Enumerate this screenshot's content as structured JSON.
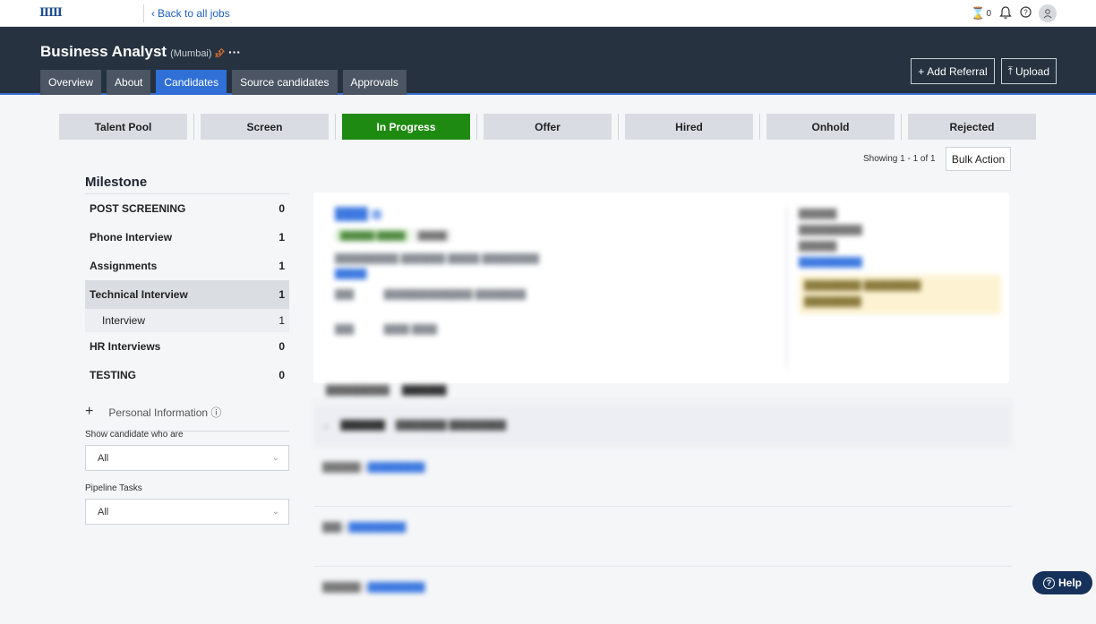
{
  "topbar": {
    "logo_text": "ⅡⅢ",
    "back_label": "Back to all jobs",
    "hourglass_count": "0"
  },
  "header": {
    "job_title": "Business Analyst",
    "location": "(Mumbai)",
    "tabs": [
      "Overview",
      "About",
      "Candidates",
      "Source candidates",
      "Approvals"
    ],
    "active_tab": "Candidates",
    "add_referral_label": "Add Referral",
    "upload_label": "Upload"
  },
  "stages": [
    "Talent Pool",
    "Screen",
    "In Progress",
    "Offer",
    "Hired",
    "Onhold",
    "Rejected"
  ],
  "active_stage": "In Progress",
  "showing_text": "Showing 1 - 1 of 1",
  "bulk_action_label": "Bulk Action",
  "milestone": {
    "title": "Milestone",
    "items": [
      {
        "label": "POST SCREENING",
        "count": "0"
      },
      {
        "label": "Phone Interview",
        "count": "1"
      },
      {
        "label": "Assignments",
        "count": "1"
      },
      {
        "label": "Technical Interview",
        "count": "1"
      },
      {
        "label": "Interview",
        "count": "1"
      },
      {
        "label": "HR Interviews",
        "count": "0"
      },
      {
        "label": "TESTING",
        "count": "0"
      }
    ]
  },
  "personal_info_label": "Personal Information",
  "filters": {
    "show_label": "Show candidate who are",
    "show_value": "All",
    "pipeline_label": "Pipeline Tasks",
    "pipeline_value": "All"
  },
  "help_label": "Help"
}
